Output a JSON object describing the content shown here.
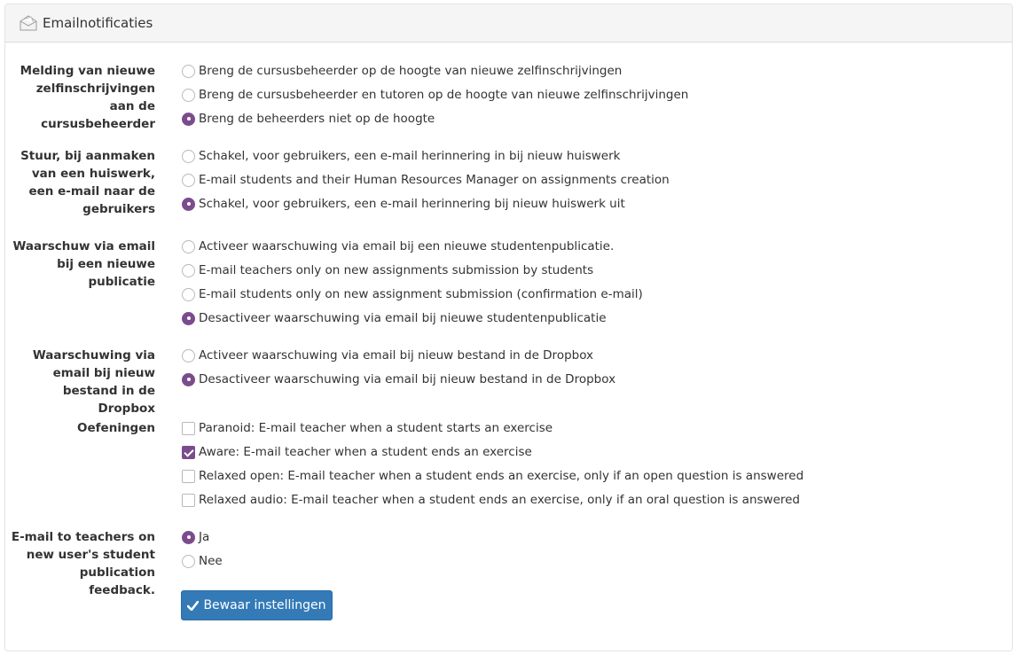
{
  "header": {
    "title": "Emailnotificaties",
    "icon": "envelope-icon"
  },
  "sections": [
    {
      "label": "Melding van nieuwe zelfinschrijvingen aan de cursusbeheerder",
      "type": "radio",
      "options": [
        {
          "text": "Breng de cursusbeheerder op de hoogte van nieuwe zelfinschrijvingen",
          "checked": false
        },
        {
          "text": "Breng de cursusbeheerder en tutoren op de hoogte van nieuwe zelfinschrijvingen",
          "checked": false
        },
        {
          "text": "Breng de beheerders niet op de hoogte",
          "checked": true
        }
      ]
    },
    {
      "label": "Stuur, bij aanmaken van een huiswerk, een e-mail naar de gebruikers",
      "type": "radio",
      "options": [
        {
          "text": "Schakel, voor gebruikers, een e-mail herinnering in bij nieuw huiswerk",
          "checked": false
        },
        {
          "text": "E-mail students and their Human Resources Manager on assignments creation",
          "checked": false
        },
        {
          "text": "Schakel, voor gebruikers, een e-mail herinnering bij nieuw huiswerk uit",
          "checked": true
        }
      ]
    },
    {
      "label": "Waarschuw via email bij een nieuwe publicatie",
      "type": "radio",
      "options": [
        {
          "text": "Activeer waarschuwing via email bij een nieuwe studentenpublicatie.",
          "checked": false
        },
        {
          "text": "E-mail teachers only on new assignments submission by students",
          "checked": false
        },
        {
          "text": "E-mail students only on new assignment submission (confirmation e-mail)",
          "checked": false
        },
        {
          "text": "Desactiveer waarschuwing via email bij nieuwe studentenpublicatie",
          "checked": true
        }
      ]
    },
    {
      "label": "Waarschuwing via email bij nieuw bestand in de Dropbox",
      "type": "radio",
      "options": [
        {
          "text": "Activeer waarschuwing via email bij nieuw bestand in de Dropbox",
          "checked": false
        },
        {
          "text": "Desactiveer waarschuwing via email bij nieuw bestand in de Dropbox",
          "checked": true
        }
      ]
    },
    {
      "label": "Oefeningen",
      "type": "checkbox",
      "options": [
        {
          "text": "Paranoid: E-mail teacher when a student starts an exercise",
          "checked": false
        },
        {
          "text": "Aware: E-mail teacher when a student ends an exercise",
          "checked": true
        },
        {
          "text": "Relaxed open: E-mail teacher when a student ends an exercise, only if an open question is answered",
          "checked": false
        },
        {
          "text": "Relaxed audio: E-mail teacher when a student ends an exercise, only if an oral question is answered",
          "checked": false
        }
      ]
    },
    {
      "label": "E-mail to teachers on new user's student publication feedback.",
      "type": "radio",
      "options": [
        {
          "text": "Ja",
          "checked": true
        },
        {
          "text": "Nee",
          "checked": false
        }
      ]
    }
  ],
  "save_button": {
    "label": "Bewaar instellingen",
    "icon": "check-icon"
  },
  "colors": {
    "accent": "#7b4c8d",
    "button": "#337ab7",
    "heading_bg": "#f5f5f5"
  }
}
